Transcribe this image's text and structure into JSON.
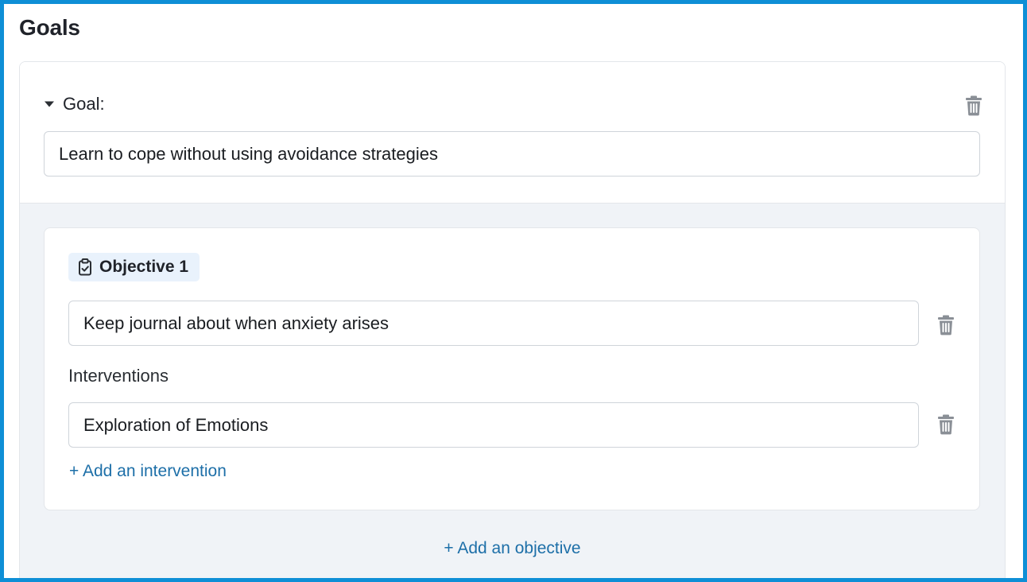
{
  "page": {
    "title": "Goals",
    "accent_color": "#0e8fd6",
    "link_color": "#1d6fa8"
  },
  "goal": {
    "toggle_icon": "caret-down-icon",
    "label": "Goal:",
    "value": "Learn to cope without using avoidance strategies",
    "delete_icon": "trash-icon"
  },
  "objectives": [
    {
      "badge_icon": "clipboard-check-icon",
      "title": "Objective 1",
      "value": "Keep journal about when anxiety arises",
      "delete_icon": "trash-icon",
      "interventions_label": "Interventions",
      "interventions": [
        {
          "value": "Exploration of Emotions",
          "delete_icon": "trash-icon"
        }
      ],
      "add_intervention_label": "+ Add an intervention"
    }
  ],
  "add_objective_label": "+ Add an objective"
}
